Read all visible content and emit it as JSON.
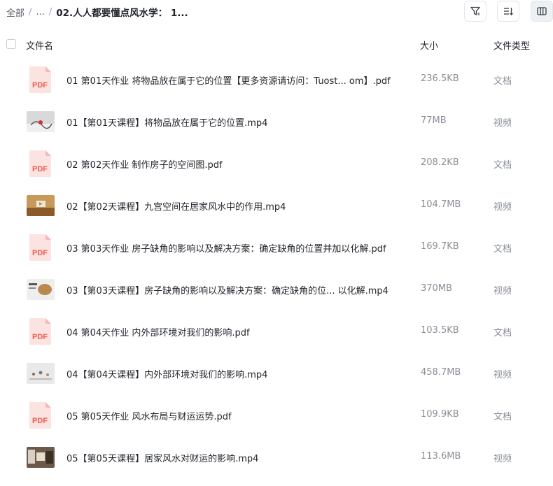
{
  "breadcrumb": {
    "root": "全部",
    "ellipsis": "...",
    "current": "02.人人都要懂点风水学： 1..."
  },
  "columns": {
    "name": "文件名",
    "size": "大小",
    "type": "文件类型"
  },
  "pdf_label": "PDF",
  "files": [
    {
      "name": "01 第01天作业 将物品放在属于它的位置【更多资源请访问：Tuost... om】.pdf",
      "size": "236.5KB",
      "type": "文档",
      "kind": "pdf"
    },
    {
      "name": "01【第01天课程】将物品放在属于它的位置.mp4",
      "size": "77MB",
      "type": "视频",
      "kind": "video",
      "thumb": "grey"
    },
    {
      "name": "02 第02天作业 制作房子的空间图.pdf",
      "size": "208.2KB",
      "type": "文档",
      "kind": "pdf"
    },
    {
      "name": "02【第02天课程】九宫空间在居家风水中的作用.mp4",
      "size": "104.7MB",
      "type": "视频",
      "kind": "video",
      "thumb": "wood"
    },
    {
      "name": "03 第03天作业 房子缺角的影响以及解决方案：确定缺角的位置并加以化解.pdf",
      "size": "169.7KB",
      "type": "文档",
      "kind": "pdf"
    },
    {
      "name": "03【第03天课程】房子缺角的影响以及解决方案：确定缺角的位... 以化解.mp4",
      "size": "370MB",
      "type": "视频",
      "kind": "video",
      "thumb": "amber"
    },
    {
      "name": "04 第04天作业 内外部环境对我们的影响.pdf",
      "size": "103.5KB",
      "type": "文档",
      "kind": "pdf"
    },
    {
      "name": "04【第04天课程】内外部环境对我们的影响.mp4",
      "size": "458.7MB",
      "type": "视频",
      "kind": "video",
      "thumb": "light"
    },
    {
      "name": "05 第05天作业 风水布局与财运运势.pdf",
      "size": "109.9KB",
      "type": "文档",
      "kind": "pdf"
    },
    {
      "name": "05【第05天课程】居家风水对财运的影响.mp4",
      "size": "113.6MB",
      "type": "视频",
      "kind": "video",
      "thumb": "dark"
    }
  ],
  "icons": {
    "filter": "filter-icon",
    "sort": "sort-icon",
    "layout": "column-layout-icon",
    "pdf": "pdf-file-icon",
    "video": "video-thumbnail"
  },
  "colors": {
    "pdf_red": "#f25a4e",
    "text": "#1f2329",
    "muted": "#8a8f96"
  }
}
